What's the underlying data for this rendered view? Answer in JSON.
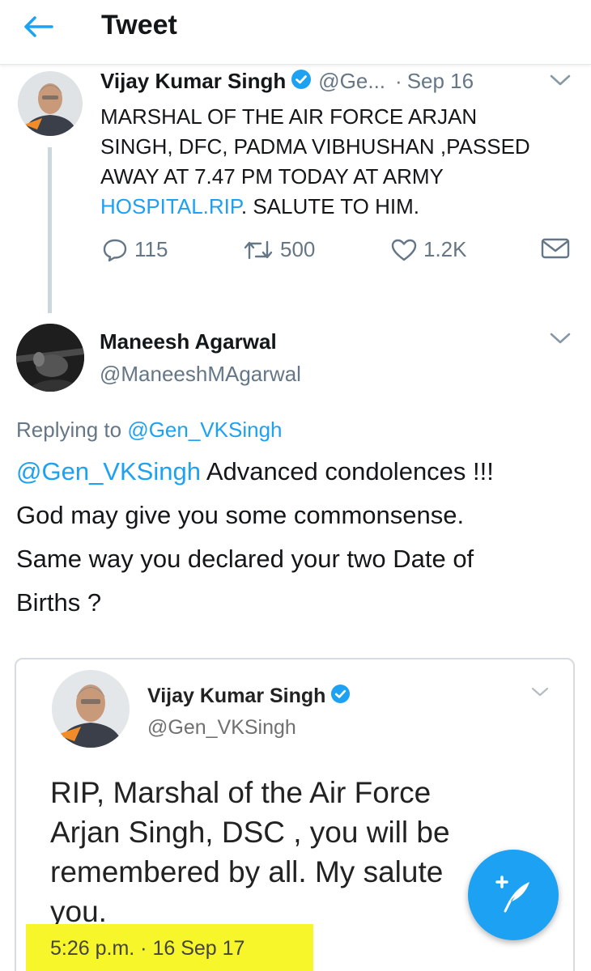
{
  "header": {
    "title": "Tweet",
    "back_icon": "arrow-left-icon"
  },
  "original_tweet": {
    "author_name": "Vijay Kumar Singh",
    "handle": "@Ge...",
    "separator": "·",
    "date": "Sep 16",
    "text_lines": [
      "MARSHAL OF THE AIR FORCE ARJAN",
      "SINGH, DFC, PADMA VIBHUSHAN ,PASSED",
      "AWAY AT 7.47  PM  TODAY AT ARMY"
    ],
    "link_text": "HOSPITAL.RIP",
    "text_after_link": ". SALUTE TO HIM.",
    "actions": {
      "replies": "115",
      "retweets": "500",
      "likes": "1.2K"
    }
  },
  "reply_tweet": {
    "author_name": "Maneesh Agarwal",
    "handle": "@ManeeshMAgarwal",
    "replying_to_label": "Replying to",
    "replying_to_handle": "@Gen_VKSingh",
    "mention": "@Gen_VKSingh",
    "text_line1_rest": " Advanced condolences !!!",
    "text_lines": [
      "God may give you some commonsense.",
      "Same way you declared your two Date of",
      "Births ?"
    ]
  },
  "embedded_screenshot": {
    "author_name": "Vijay Kumar Singh",
    "handle": "@Gen_VKSingh",
    "text_lines": [
      "RIP, Marshal of the Air Force",
      "Arjan Singh, DSC , you will be",
      "remembered by all. My salute",
      "you."
    ],
    "timestamp": "5:26 p.m. · 16 Sep 17",
    "highlight_color": "#f6f62a"
  },
  "colors": {
    "accent": "#1da1f2",
    "text": "#14171a",
    "muted": "#657786"
  }
}
